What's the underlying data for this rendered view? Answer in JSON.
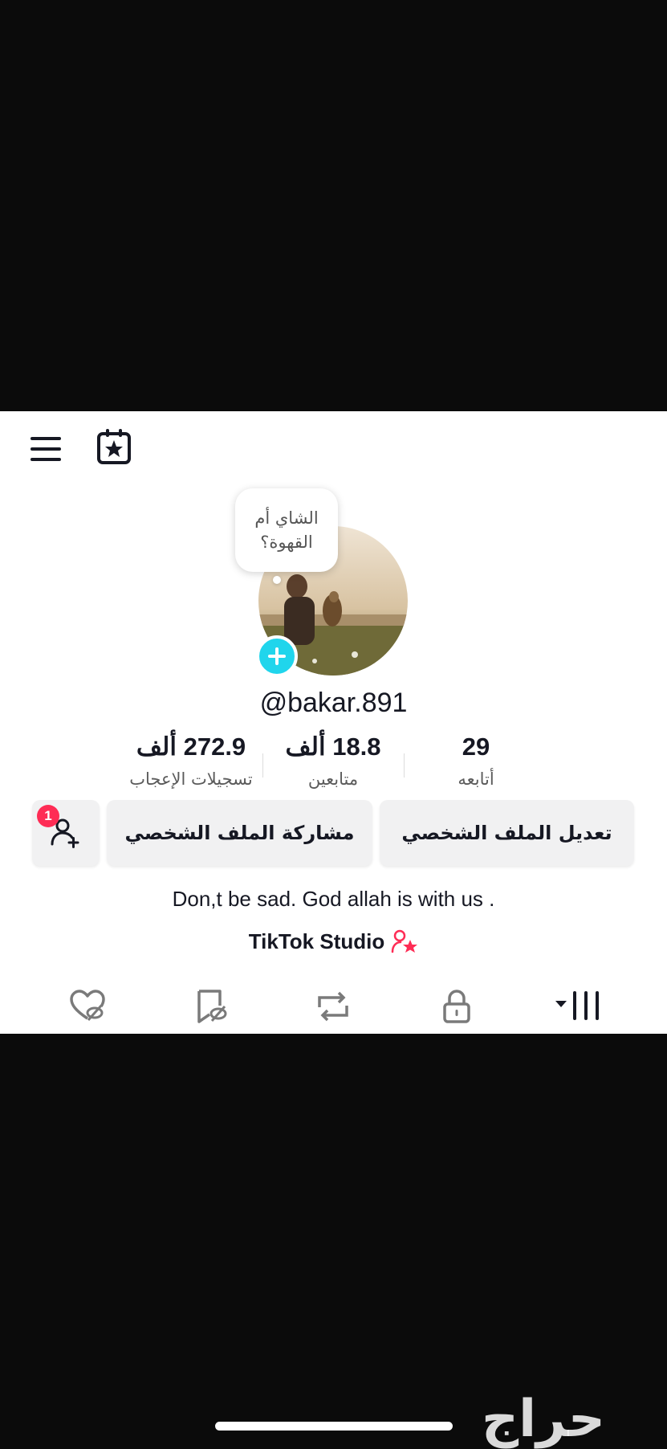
{
  "profile": {
    "username": "@bakar.891",
    "bubble_line1": "الشاي أم",
    "bubble_line2": "القهوة؟",
    "bio": "Don,t be sad. God allah is with us .",
    "studio_label": "TikTok Studio"
  },
  "stats": {
    "likes": {
      "value": "272.9 ألف",
      "label": "تسجيلات الإعجاب"
    },
    "followers": {
      "value": "18.8 ألف",
      "label": "متابعين"
    },
    "following": {
      "value": "29",
      "label": "أتابعه"
    }
  },
  "buttons": {
    "edit_profile": "تعديل الملف الشخصي",
    "share_profile": "مشاركة الملف الشخصي",
    "friend_badge_count": "1"
  },
  "tabs": [
    "liked-icon",
    "favorites-icon",
    "reposts-icon",
    "private-icon",
    "videos-grid-icon"
  ],
  "colors": {
    "accent_cyan": "#20d5ec",
    "badge_red": "#fe2c55",
    "text": "#161823"
  },
  "watermark": "حراج"
}
